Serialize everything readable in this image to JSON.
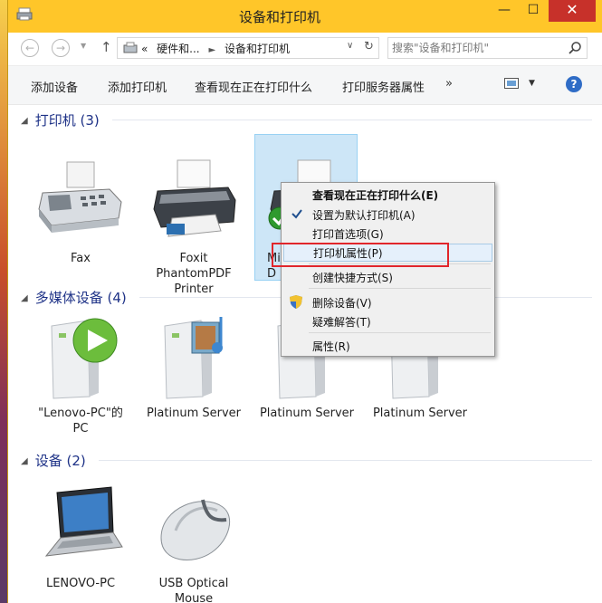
{
  "window": {
    "title": "设备和打印机",
    "min_glyph": "—",
    "max_glyph": "☐",
    "close_glyph": "✕"
  },
  "nav": {
    "breadcrumb": [
      "硬件和...",
      "设备和打印机"
    ],
    "breadcrumb_prefix": "«",
    "search_placeholder": "搜索\"设备和打印机\""
  },
  "toolbar": {
    "items": [
      "添加设备",
      "添加打印机",
      "查看现在正在打印什么",
      "打印服务器属性"
    ],
    "more": "»"
  },
  "groups": {
    "printers": {
      "header": "打印机 (3)",
      "items": [
        {
          "label": "Fax",
          "icon": "fax-icon"
        },
        {
          "label": "Foxit PhantomPDF Printer",
          "icon": "printer-icon"
        },
        {
          "label": "Mi",
          "label_line2": "D",
          "icon": "default-printer-icon"
        }
      ]
    },
    "media": {
      "header": "多媒体设备 (4)",
      "items": [
        {
          "label": "\"Lenovo-PC\"的 PC",
          "icon": "media-pc-icon"
        },
        {
          "label": "Platinum Server",
          "icon": "media-server-icon"
        },
        {
          "label": "Platinum Server",
          "icon": "media-server-icon"
        },
        {
          "label": "Platinum Server",
          "icon": "media-server-icon"
        }
      ]
    },
    "devices": {
      "header": "设备 (2)",
      "items": [
        {
          "label": "LENOVO-PC",
          "icon": "laptop-icon"
        },
        {
          "label": "USB Optical Mouse",
          "icon": "mouse-icon"
        }
      ]
    }
  },
  "context_menu": {
    "items": [
      {
        "label": "查看现在正在打印什么(E)",
        "bold": true
      },
      {
        "label": "设置为默认打印机(A)",
        "checked": true
      },
      {
        "label": "打印首选项(G)"
      },
      {
        "label": "打印机属性(P)",
        "highlighted": true
      },
      {
        "label": "创建快捷方式(S)"
      },
      {
        "label": "删除设备(V)",
        "icon": "shield-icon"
      },
      {
        "label": "疑难解答(T)"
      },
      {
        "label": "属性(R)"
      }
    ]
  },
  "colors": {
    "titlebar": "#ffc629",
    "close": "#c7312a",
    "group_header": "#1e3287",
    "selection": "#cde6f7",
    "highlight_box": "#e1262b"
  }
}
